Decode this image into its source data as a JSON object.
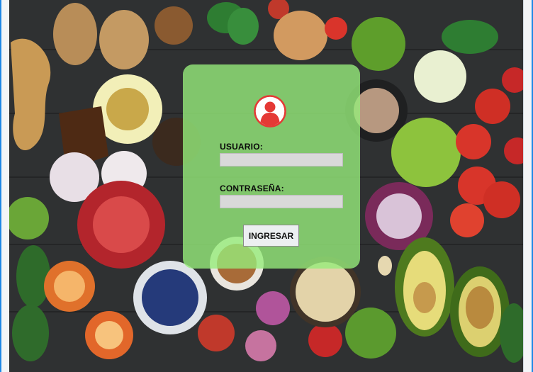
{
  "form": {
    "username_label": "USUARIO:",
    "username_value": "",
    "password_label": "CONTRASEÑA:",
    "password_value": "",
    "submit_label": "INGRESAR"
  },
  "icons": {
    "avatar": "user-icon"
  },
  "colors": {
    "card": "#96EC7A",
    "avatar_red": "#E53935",
    "window_border": "#1E88E5"
  }
}
